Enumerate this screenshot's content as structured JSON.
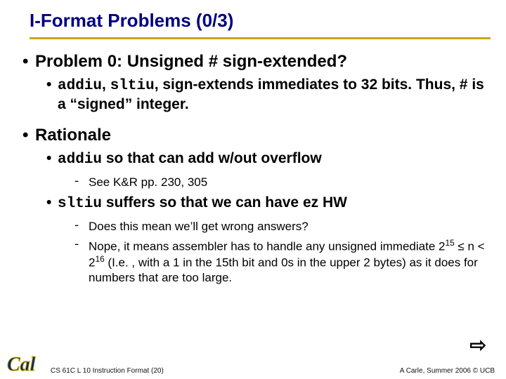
{
  "title": "I-Format Problems (0/3)",
  "bullets": {
    "problem0": "Problem 0: Unsigned # sign-extended?",
    "sub1_prefix": "addiu",
    "sub1_mid1": ", ",
    "sub1_code2": "sltiu",
    "sub1_mid2": ", ",
    "sub1_rest": "sign-extends immediates to 32 bits. Thus, # is a “signed” integer.",
    "rationale": "Rationale",
    "r1_code": "addiu",
    "r1_rest": " so that can add w/out overflow",
    "r1_sub": "See K&R pp. 230, 305",
    "r2_code": "sltiu",
    "r2_rest": " suffers so that we can have ez HW",
    "r2_sub1": "Does this mean we’ll get wrong answers?",
    "r2_sub2_a": "Nope, it means assembler has to handle any unsigned immediate 2",
    "r2_sub2_b": "15",
    "r2_sub2_c": " ≤ n < 2",
    "r2_sub2_d": "16",
    "r2_sub2_e": " (I.e. , with a 1 in the 15th bit and 0s in the upper 2 bytes) as it does for numbers that are too large."
  },
  "arrow": "⇨",
  "footer": {
    "left": "CS 61C L 10 Instruction Format (20)",
    "right": "A Carle, Summer 2006 © UCB"
  },
  "logo_alt": "Cal"
}
